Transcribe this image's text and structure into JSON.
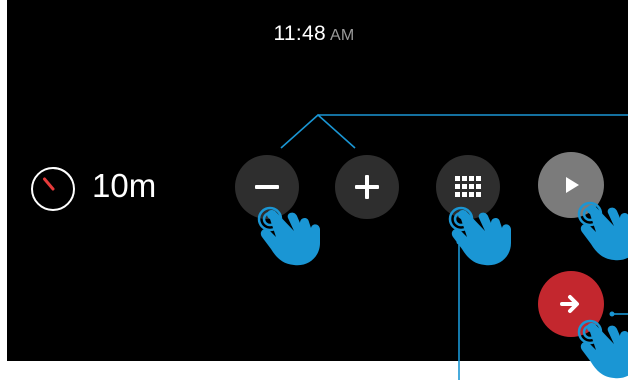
{
  "status_bar": {
    "time": "11:48",
    "period": "AM"
  },
  "timer": {
    "label": "10m",
    "icon": "timer-dial-icon"
  },
  "controls": {
    "decrease_icon": "minus-icon",
    "increase_icon": "plus-icon",
    "keypad_icon": "keypad-grid-icon",
    "play_icon": "play-icon",
    "next_icon": "arrow-right-icon"
  },
  "colors": {
    "screen_bg": "#000000",
    "button_dark": "#2e2e2e",
    "button_gray": "#7b7b7b",
    "button_red": "#c3272e",
    "annotation_blue": "#1a96d4",
    "timer_hand": "#e63b3b"
  },
  "annotations": {
    "gesture_icon": "tap-hand-icon"
  }
}
